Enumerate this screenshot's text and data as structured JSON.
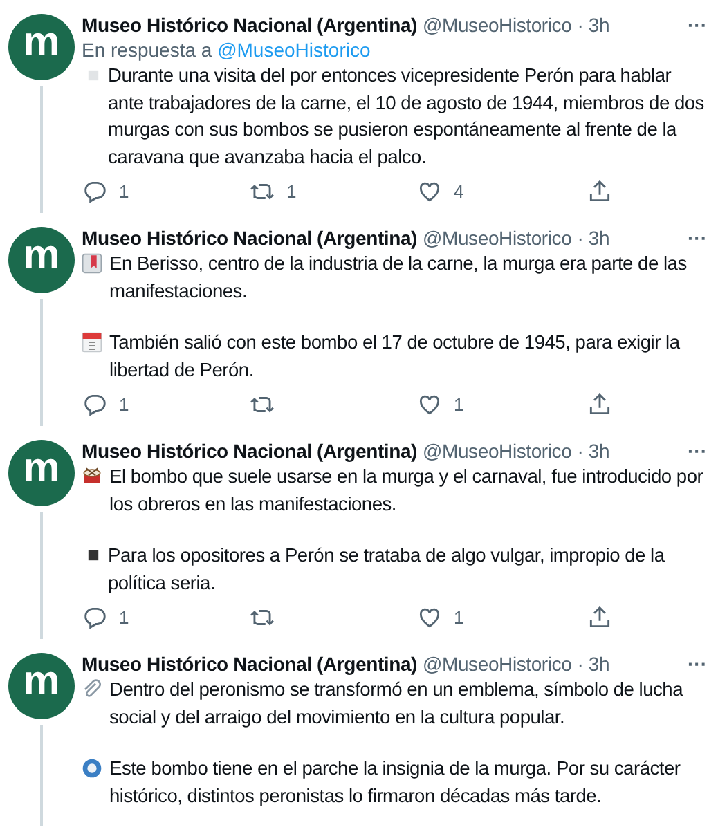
{
  "tweets": [
    {
      "avatar_letter": "m",
      "name": "Museo Histórico Nacional (Argentina)",
      "handle": "@MuseoHistorico",
      "time": "· 3h",
      "more": "···",
      "reply_prefix": "En respuesta a",
      "reply_to": "@MuseoHistorico",
      "paragraphs": [
        {
          "kind": "white-square",
          "text": "Durante una visita del por entonces vicepresidente Perón para hablar ante trabajadores de la carne, el 10 de agosto de 1944, miembros de dos murgas con sus bombos se pusieron espontáneamente al frente de la caravana que avanzaba hacia el palco."
        }
      ],
      "actions": {
        "replies": "1",
        "retweets": "1",
        "likes": "4"
      }
    },
    {
      "avatar_letter": "m",
      "name": "Museo Histórico Nacional (Argentina)",
      "handle": "@MuseoHistorico",
      "time": "· 3h",
      "more": "···",
      "paragraphs": [
        {
          "kind": "bookmark",
          "text": "En Berisso, centro de la industria de la carne, la murga era parte de las manifestaciones."
        },
        {
          "kind": "calendar",
          "text": "También salió con este bombo el 17 de octubre de 1945, para exigir la libertad de Perón."
        }
      ],
      "actions": {
        "replies": "1",
        "likes": "1"
      }
    },
    {
      "avatar_letter": "m",
      "name": "Museo Histórico Nacional (Argentina)",
      "handle": "@MuseoHistorico",
      "time": "· 3h",
      "more": "···",
      "paragraphs": [
        {
          "kind": "drum",
          "text": "El bombo que suele usarse en la murga y el carnaval, fue introducido por los obreros en las manifestaciones."
        },
        {
          "kind": "black-square",
          "text": "Para los opositores a Perón se trataba de algo vulgar, impropio de la política seria."
        }
      ],
      "actions": {
        "replies": "1",
        "likes": "1"
      }
    },
    {
      "avatar_letter": "m",
      "name": "Museo Histórico Nacional (Argentina)",
      "handle": "@MuseoHistorico",
      "time": "· 3h",
      "more": "···",
      "paragraphs": [
        {
          "kind": "paperclip",
          "text": "Dentro del peronismo se transformó en un emblema, símbolo de lucha social y del arraigo del movimiento en la cultura popular."
        },
        {
          "kind": "radio-dot",
          "text": "Este bombo tiene en el parche la insignia de la murga. Por su carácter histórico, distintos peronistas lo firmaron décadas más tarde."
        }
      ]
    }
  ]
}
